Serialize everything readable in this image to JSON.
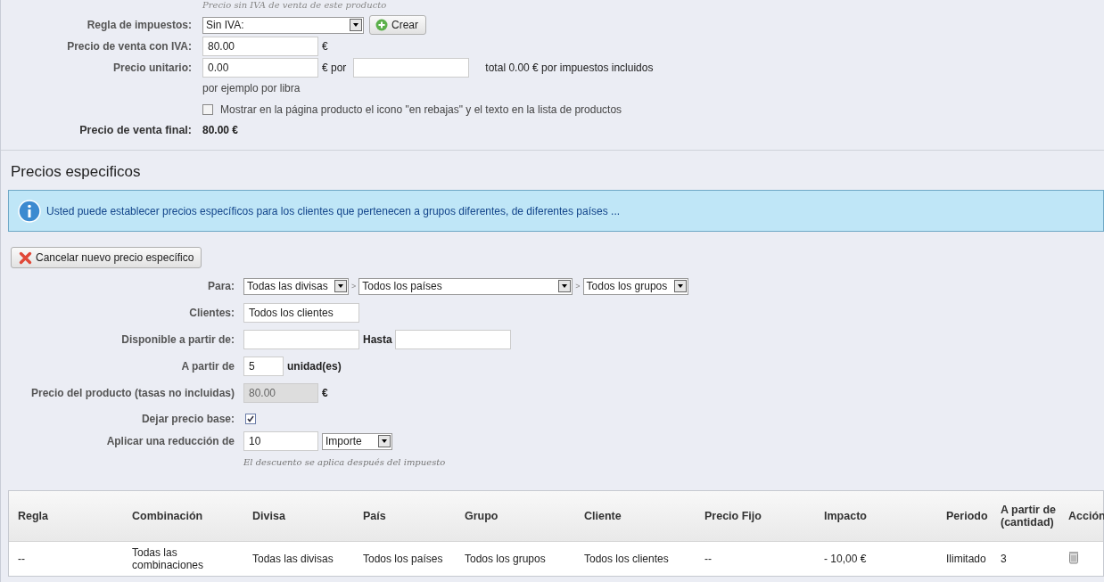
{
  "top_note": "Precio sin IVA de venta de este producto",
  "price_form": [
    {
      "kind": "select",
      "label": "Regla de impuestos:",
      "value": "Sin IVA:",
      "button": "Crear"
    },
    {
      "kind": "input",
      "label": "Precio de venta con IVA:",
      "value": "80.00",
      "suffix": "€"
    },
    {
      "kind": "unit",
      "label": "Precio unitario:",
      "value": "0.00",
      "suffix": "€ por",
      "total": "total 0.00 € por impuestos incluidos"
    },
    {
      "kind": "hint",
      "text": "por ejemplo por libra"
    },
    {
      "kind": "checkbox",
      "checked": false,
      "text": "Mostrar en la página producto el icono \"en rebajas\" y el texto en la lista de productos"
    },
    {
      "kind": "final",
      "label": "Precio de venta final:",
      "value": "80.00 €"
    }
  ],
  "section_title": "Precios especificos",
  "info": "Usted puede establecer precios específicos para los clientes que pertenecen a grupos diferentes, de diferentes países ...",
  "cancel_button": "Cancelar nuevo precio específico",
  "specific_form": [
    {
      "kind": "selects",
      "label": "Para:",
      "separator": ">",
      "selects": [
        {
          "value": "Todas las divisas"
        },
        {
          "value": "Todos los países"
        },
        {
          "value": "Todos los grupos"
        }
      ]
    },
    {
      "kind": "input",
      "label": "Clientes:",
      "value": "Todos los clientes"
    },
    {
      "kind": "range",
      "label": "Disponible a partir de:",
      "middle": "Hasta"
    },
    {
      "kind": "quantity",
      "label": "A partir de",
      "value": "5",
      "suffix": "unidad(es)"
    },
    {
      "kind": "input",
      "label": "Precio del producto (tasas no incluidas)",
      "value": "80.00",
      "suffix": "€",
      "disabled": true
    },
    {
      "kind": "checkbox",
      "label": "Dejar precio base:",
      "checked": true
    },
    {
      "kind": "reduction",
      "label": "Aplicar una reducción de",
      "value": "10",
      "select": "Importe"
    },
    {
      "kind": "note",
      "text": "El descuento se aplica después del impuesto"
    }
  ],
  "table": {
    "columns": [
      "Regla",
      "Combinación",
      "Divisa",
      "País",
      "Grupo",
      "Cliente",
      "Precio Fijo",
      "Impacto",
      "Periodo",
      "A partir de (cantidad)",
      "Acción"
    ],
    "rows": [
      [
        "--",
        "Todas las combinaciones",
        "Todas las divisas",
        "Todos los países",
        "Todos los grupos",
        "Todos los clientes",
        "--",
        "- 10,00 €",
        "Ilimitado",
        "3"
      ]
    ]
  }
}
